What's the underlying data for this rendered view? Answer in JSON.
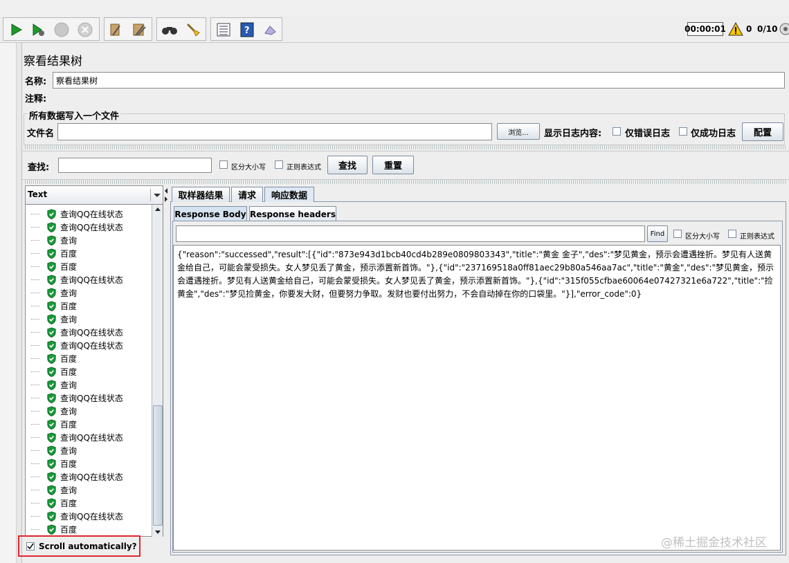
{
  "toolbar": {
    "timer": "00:00:01",
    "warning_count": "0",
    "threads": "0/10",
    "icons": [
      "play-icon",
      "play-no-pause-icon",
      "stop-icon",
      "shutdown-icon",
      "clear-icon",
      "clear-all-icon",
      "search-icon",
      "reset-search-icon",
      "function-helper-icon",
      "help-icon",
      "remote-icon"
    ]
  },
  "panel": {
    "title": "察看结果树",
    "name_label": "名称:",
    "name_value": "察看结果树",
    "comment_label": "注释:",
    "file_section_title": "所有数据写入一个文件",
    "filename_label": "文件名",
    "browse_button": "浏览...",
    "log_display_label": "显示日志内容:",
    "errors_only_label": "仅错误日志",
    "success_only_label": "仅成功日志",
    "configure_button": "配置"
  },
  "search": {
    "label": "查找:",
    "case_sensitive_label": "区分大小写",
    "regex_label": "正则表达式",
    "search_button": "查找",
    "reset_button": "重置"
  },
  "tree": {
    "renderer_selected": "Text",
    "items": [
      "查询QQ在线状态",
      "查询QQ在线状态",
      "查询",
      "百度",
      "百度",
      "查询QQ在线状态",
      "查询",
      "百度",
      "查询",
      "查询QQ在线状态",
      "查询QQ在线状态",
      "百度",
      "百度",
      "查询",
      "查询QQ在线状态",
      "查询",
      "百度",
      "查询QQ在线状态",
      "查询",
      "百度",
      "查询QQ在线状态",
      "查询",
      "百度",
      "查询QQ在线状态",
      "百度"
    ],
    "scroll_auto_label": "Scroll automatically?"
  },
  "result_tabs": [
    "取样器结果",
    "请求",
    "响应数据"
  ],
  "response_tabs": [
    "Response Body",
    "Response headers"
  ],
  "response_search": {
    "find_button": "Find",
    "case_sensitive_label": "区分大小写",
    "regex_label": "正则表达式"
  },
  "response_body": "{\"reason\":\"successed\",\"result\":[{\"id\":\"873e943d1bcb40cd4b289e0809803343\",\"title\":\"黄金 金子\",\"des\":\"梦见黄金，预示会遭遇挫折。梦见有人送黄金给自己，可能会蒙受损失。女人梦见丢了黄金，预示添置新首饰。\"},{\"id\":\"237169518a0ff81aec29b80a546aa7ac\",\"title\":\"黄金\",\"des\":\"梦见黄金，预示会遭遇挫折。梦见有人送黄金给自己，可能会蒙受损失。女人梦见丢了黄金，预示添置新首饰。\"},{\"id\":\"315f055cfbae60064e07427321e6a722\",\"title\":\"捡黄金\",\"des\":\"梦见捡黄金，你要发大财，但要努力争取。发财也要付出努力，不会自动掉在你的口袋里。\"}],\"error_code\":0}",
  "watermark": "@稀土掘金技术社区"
}
